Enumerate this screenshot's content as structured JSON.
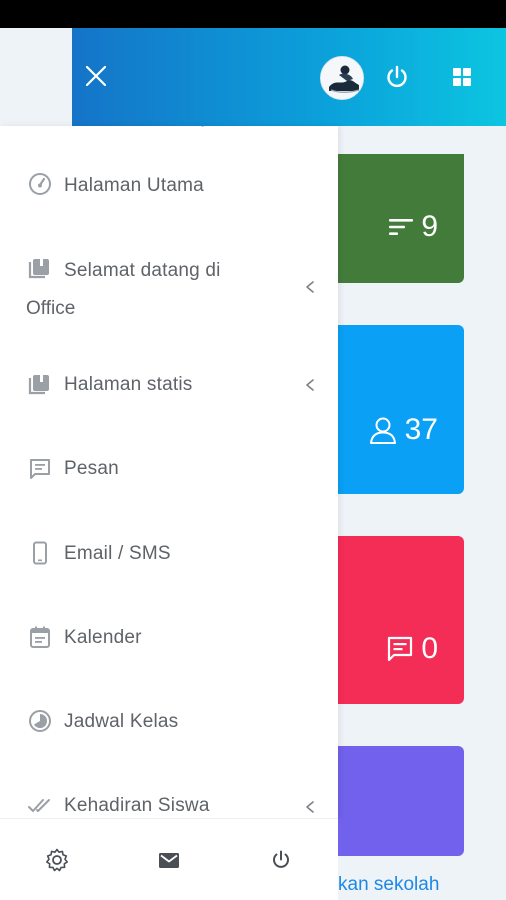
{
  "main": {
    "cards": [
      {
        "value": "9",
        "icon": "sort-lines-icon",
        "color": "#437c3a"
      },
      {
        "value": "37",
        "icon": "user-icon",
        "color": "#0aa0f5"
      },
      {
        "value": "0",
        "icon": "message-icon",
        "color": "#f42d57"
      },
      {
        "value": "",
        "icon": "",
        "color": "#7161ec"
      }
    ],
    "bottom_link": "kan sekolah"
  },
  "header": {
    "close_icon": "close-icon",
    "power_icon": "power-icon",
    "apps_icon": "apps-grid-icon",
    "gradient_start": "#1574c8",
    "gradient_end": "#0cc5e0"
  },
  "drawer": {
    "items": [
      {
        "label": "Halaman Utama",
        "icon": "dashboard-gauge-icon"
      },
      {
        "label": "Selamat datang di",
        "label_line2": "Office",
        "icon": "book-icon",
        "has_children": true
      },
      {
        "label": "Halaman statis",
        "icon": "book-icon",
        "has_children": true
      },
      {
        "label": "Pesan",
        "icon": "message-icon"
      },
      {
        "label": "Email / SMS",
        "icon": "phone-icon"
      },
      {
        "label": "Kalender",
        "icon": "calendar-icon"
      },
      {
        "label": "Jadwal Kelas",
        "icon": "clock-icon"
      },
      {
        "label": "Kehadiran Siswa",
        "icon": "double-check-icon",
        "has_children": true
      }
    ],
    "footer": {
      "settings_icon": "gear-icon",
      "mail_icon": "mail-icon",
      "power_icon": "power-icon"
    }
  }
}
